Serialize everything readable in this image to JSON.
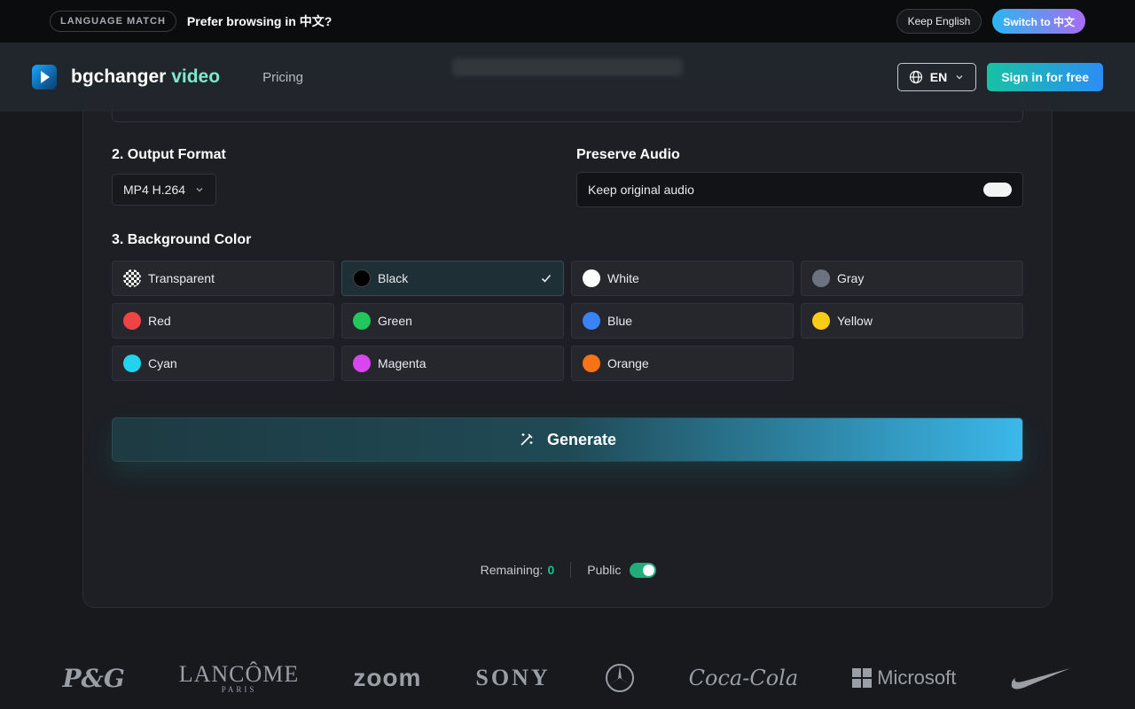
{
  "language_banner": {
    "tag": "LANGUAGE MATCH",
    "question": "Prefer browsing in 中文?",
    "keep_label": "Keep English",
    "switch_label": "Switch to 中文"
  },
  "header": {
    "logo_main": "bgchanger",
    "logo_accent": "video",
    "nav_pricing": "Pricing",
    "language": "EN",
    "signin_label": "Sign in for free"
  },
  "output_format": {
    "label": "2. Output Format",
    "selected": "MP4 H.264"
  },
  "preserve_audio": {
    "label": "Preserve Audio",
    "option_label": "Keep original audio"
  },
  "background_color": {
    "label": "3. Background Color",
    "selected": "Black",
    "options": [
      {
        "label": "Transparent",
        "color": "checker"
      },
      {
        "label": "Black",
        "color": "#000000"
      },
      {
        "label": "White",
        "color": "#ffffff"
      },
      {
        "label": "Gray",
        "color": "#6b7280"
      },
      {
        "label": "Red",
        "color": "#ef4444"
      },
      {
        "label": "Green",
        "color": "#22c55e"
      },
      {
        "label": "Blue",
        "color": "#3b82f6"
      },
      {
        "label": "Yellow",
        "color": "#facc15"
      },
      {
        "label": "Cyan",
        "color": "#22d3ee"
      },
      {
        "label": "Magenta",
        "color": "#d946ef"
      },
      {
        "label": "Orange",
        "color": "#f97316"
      }
    ]
  },
  "generate_label": "Generate",
  "footer": {
    "remaining_label": "Remaining:",
    "remaining_value": "0",
    "public_label": "Public"
  },
  "brands": {
    "pg": "P&G",
    "lancome": "LANCÔME",
    "lancome_sub": "PARIS",
    "zoom": "zoom",
    "sony": "SONY",
    "coke": "Coca-Cola",
    "microsoft": "Microsoft"
  },
  "colors": {
    "accent_green": "#19c28f",
    "signin_gradient_start": "#17c2a4",
    "signin_gradient_end": "#2c8ef5",
    "generate_end": "#3bb8ea"
  }
}
